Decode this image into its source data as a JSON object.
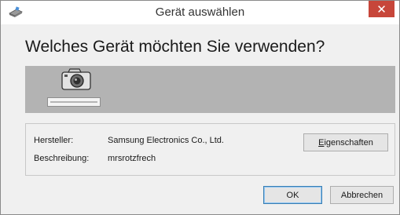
{
  "window": {
    "title": "Gerät auswählen",
    "close_glyph": "✕"
  },
  "heading": "Welches Gerät möchten Sie verwenden?",
  "devices": [
    {
      "icon": "camera-icon",
      "selected": true
    }
  ],
  "details": {
    "manufacturer_label": "Hersteller:",
    "manufacturer_value": "Samsung Electronics Co., Ltd.",
    "description_label": "Beschreibung:",
    "description_value": "mrsrotzfrech",
    "properties_button": {
      "mnemonic": "E",
      "rest": "igenschaften"
    }
  },
  "footer": {
    "ok_label": "OK",
    "cancel_label": "Abbrechen"
  },
  "colors": {
    "close_button": "#c7463a",
    "strip": "#b3b3b3",
    "dialog_bg": "#f0f0f0",
    "default_button_border": "#3c7fb1"
  }
}
